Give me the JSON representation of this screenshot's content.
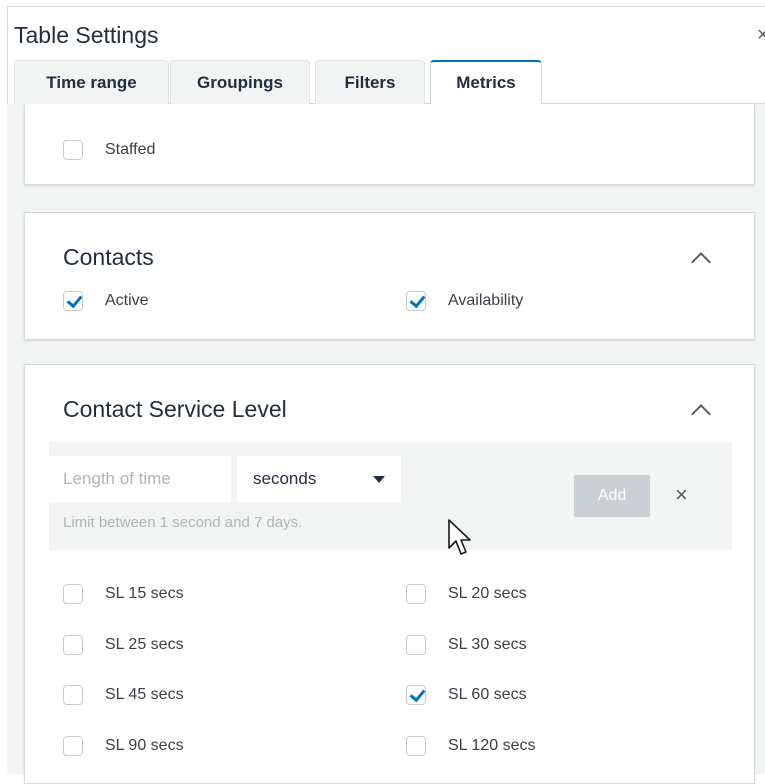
{
  "dialog": {
    "title": "Table Settings",
    "close_glyph": "×"
  },
  "tabs": [
    {
      "label": "Time range",
      "active": false
    },
    {
      "label": "Groupings",
      "active": false
    },
    {
      "label": "Filters",
      "active": false
    },
    {
      "label": "Metrics",
      "active": true
    }
  ],
  "staffed_section": {
    "item": {
      "label": "Staffed",
      "checked": false
    }
  },
  "contacts_section": {
    "title": "Contacts",
    "items": [
      {
        "label": "Active",
        "checked": true
      },
      {
        "label": "Availability",
        "checked": true
      }
    ]
  },
  "service_level_section": {
    "title": "Contact Service Level",
    "length_input": {
      "value": "",
      "placeholder": "Length of time"
    },
    "unit_select": {
      "selected": "seconds"
    },
    "hint": "Limit between 1 second and 7 days.",
    "add_label": "Add",
    "remove_glyph": "×",
    "items": [
      {
        "label": "SL 15 secs",
        "checked": false
      },
      {
        "label": "SL 20 secs",
        "checked": false
      },
      {
        "label": "SL 25 secs",
        "checked": false
      },
      {
        "label": "SL 30 secs",
        "checked": false
      },
      {
        "label": "SL 45 secs",
        "checked": false
      },
      {
        "label": "SL 60 secs",
        "checked": true
      },
      {
        "label": "SL 90 secs",
        "checked": false
      },
      {
        "label": "SL 120 secs",
        "checked": false
      }
    ]
  },
  "colors": {
    "accent": "#0073bb",
    "disabled_button": "#c9cfd3",
    "panel_background": "#f2f3f3"
  },
  "icons": {
    "close": "close-icon",
    "collapse": "chevron-up-icon",
    "dropdown": "caret-down-icon",
    "checkmark": "checkmark-icon",
    "cursor": "mouse-pointer-icon"
  }
}
